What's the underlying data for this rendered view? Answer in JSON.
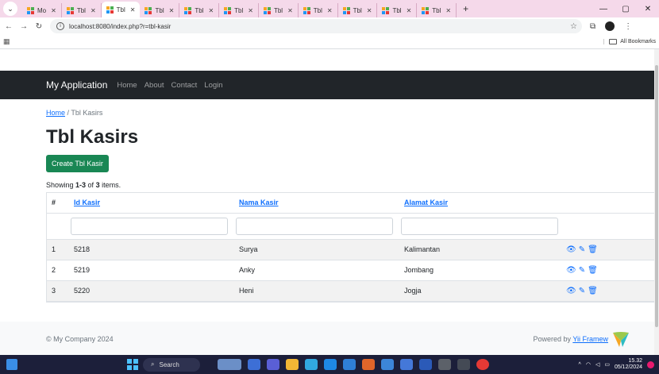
{
  "browser": {
    "tabs": [
      {
        "label": "Mo"
      },
      {
        "label": "Tbl"
      },
      {
        "label": "Tbl",
        "active": true
      },
      {
        "label": "Tbl"
      },
      {
        "label": "Tbl"
      },
      {
        "label": "Tbl"
      },
      {
        "label": "Tbl"
      },
      {
        "label": "Tbl"
      },
      {
        "label": "Tbl"
      },
      {
        "label": "Tbl"
      },
      {
        "label": "Tbl"
      }
    ],
    "url": "localhost:8080/index.php?r=tbl-kasir",
    "all_bookmarks": "All Bookmarks"
  },
  "navbar": {
    "brand": "My Application",
    "links": [
      "Home",
      "About",
      "Contact",
      "Login"
    ]
  },
  "breadcrumb": {
    "home": "Home",
    "separator": "/",
    "current": "Tbl Kasirs"
  },
  "page": {
    "title": "Tbl Kasirs",
    "create_button": "Create Tbl Kasir",
    "summary_prefix": "Showing ",
    "summary_range": "1-3",
    "summary_mid": " of ",
    "summary_total": "3",
    "summary_suffix": " items."
  },
  "table": {
    "headers": [
      "#",
      "Id Kasir",
      "Nama Kasir",
      "Alamat Kasir"
    ],
    "rows": [
      {
        "num": "1",
        "id": "5218",
        "nama": "Surya",
        "alamat": "Kalimantan"
      },
      {
        "num": "2",
        "id": "5219",
        "nama": "Anky",
        "alamat": "Jombang"
      },
      {
        "num": "3",
        "id": "5220",
        "nama": "Heni",
        "alamat": "Jogja"
      }
    ]
  },
  "footer": {
    "copyright": "© My Company 2024",
    "powered_prefix": "Powered by ",
    "powered_link": "Yii Framew"
  },
  "taskbar": {
    "search": "Search",
    "time": "15.32",
    "date": "05/12/2024"
  },
  "colors": {
    "navbar_bg": "#212529",
    "primary": "#0d6efd",
    "success": "#198754",
    "tabstrip": "#f5d9ea"
  }
}
